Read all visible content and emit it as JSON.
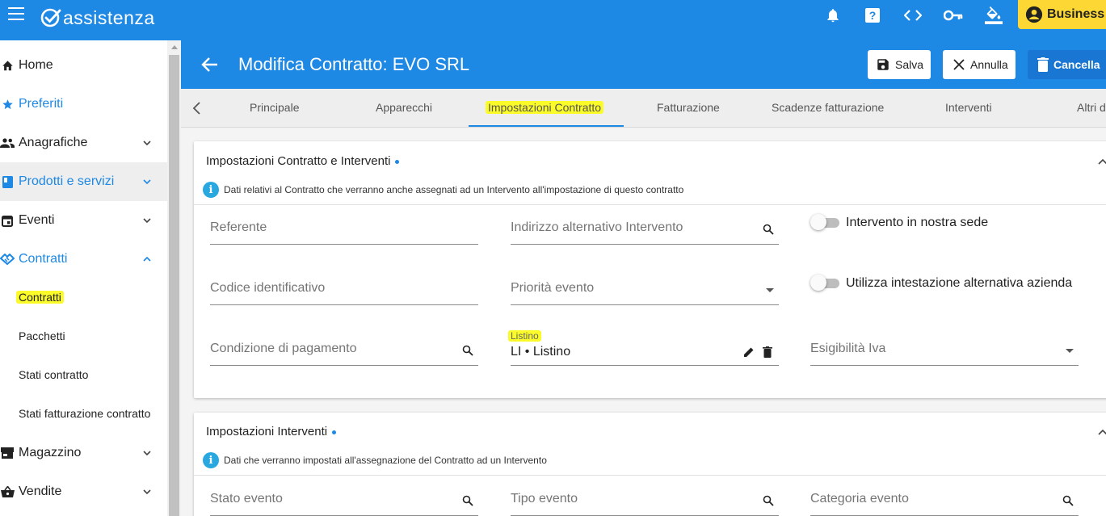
{
  "topbar": {
    "brand": "assistenza",
    "business_label": "Business",
    "icons": [
      "menu-icon",
      "bell-icon",
      "help-icon",
      "code-icon",
      "key-icon",
      "paint-bucket-icon",
      "account-icon"
    ]
  },
  "sidebar": {
    "items": [
      {
        "label": "Home",
        "icon": "home-icon"
      },
      {
        "label": "Preferiti",
        "icon": "star-icon"
      },
      {
        "label": "Anagrafiche",
        "icon": "people-icon"
      },
      {
        "label": "Prodotti e servizi",
        "icon": "book-icon"
      },
      {
        "label": "Eventi",
        "icon": "calendar-icon"
      },
      {
        "label": "Contratti",
        "icon": "handshake-icon"
      },
      {
        "label": "Magazzino",
        "icon": "store-icon"
      },
      {
        "label": "Vendite",
        "icon": "basket-icon"
      }
    ],
    "contratti_sub": [
      "Contratti",
      "Pacchetti",
      "Stati contratto",
      "Stati fatturazione contratto"
    ]
  },
  "header": {
    "title": "Modifica Contratto: EVO SRL",
    "save_label": "Salva",
    "cancel_label": "Annulla",
    "delete_label": "Cancella"
  },
  "tabs": [
    "Principale",
    "Apparecchi",
    "Impostazioni Contratto",
    "Fatturazione",
    "Scadenze fatturazione",
    "Interventi",
    "Altri d"
  ],
  "active_tab": "Impostazioni Contratto",
  "section1": {
    "title": "Impostazioni Contratto e Interventi",
    "info": "Dati relativi al Contratto che verranno anche assegnati ad un Intervento all'impostazione di questo contratto",
    "fields": {
      "referente": "Referente",
      "indirizzo": "Indirizzo alternativo Intervento",
      "codice": "Codice identificativo",
      "priorita": "Priorità evento",
      "condizione": "Condizione di pagamento",
      "listino_label": "Listino",
      "listino_value": "LI • Listino",
      "esigibilita": "Esigibilità Iva"
    },
    "toggles": {
      "sede": "Intervento in nostra sede",
      "intestazione": "Utilizza intestazione alternativa azienda"
    }
  },
  "section2": {
    "title": "Impostazioni Interventi",
    "info": "Dati che verranno impostati all'assegnazione del Contratto ad un Intervento",
    "fields": {
      "stato": "Stato evento",
      "tipo": "Tipo evento",
      "categoria": "Categoria evento"
    }
  },
  "colors": {
    "primary": "#1e88e5",
    "business": "#fdd835",
    "highlight": "#fbfb2a"
  }
}
